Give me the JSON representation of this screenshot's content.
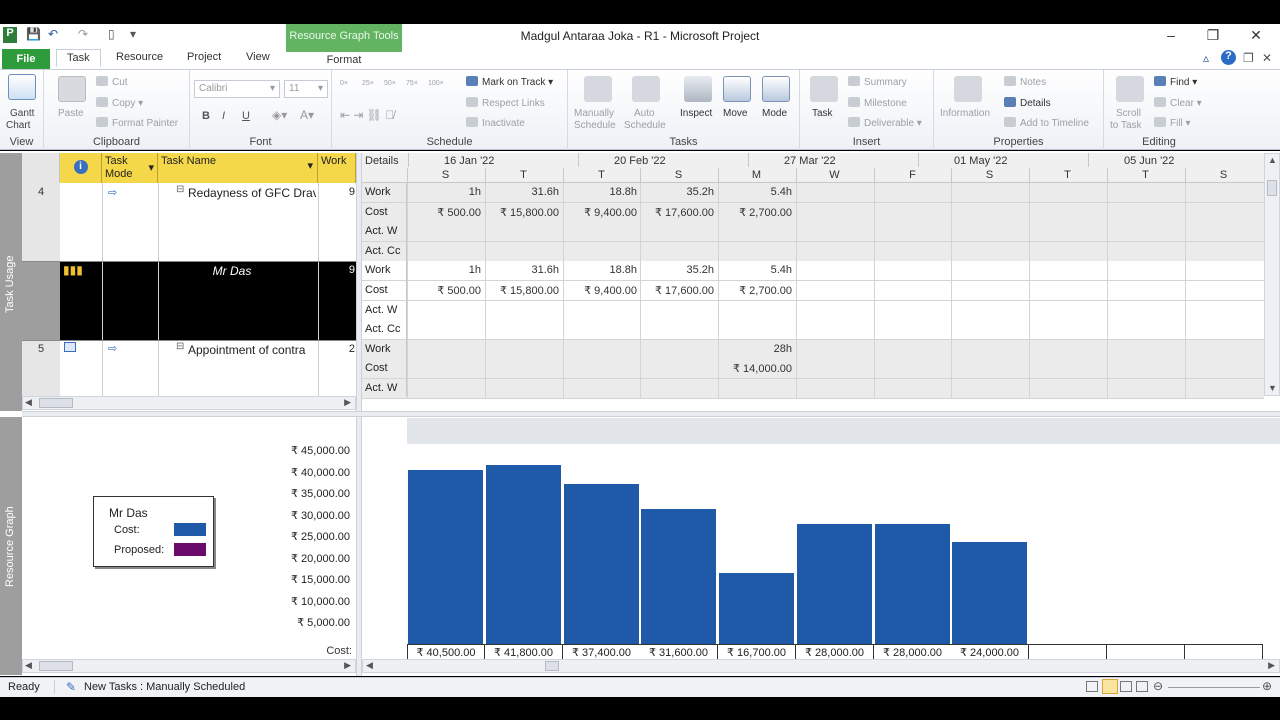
{
  "window": {
    "title": "Madgul Antaraa Joka - R1  -  Microsoft Project",
    "minimize": "–",
    "restore": "❐",
    "close": "✕"
  },
  "tabs": {
    "file": "File",
    "items": [
      "Task",
      "Resource",
      "Project",
      "View"
    ],
    "context_group": "Resource Graph Tools",
    "context_tab": "Format"
  },
  "ribbon": {
    "view": {
      "gantt": "Gantt",
      "chart": "Chart",
      "label": "View"
    },
    "clipboard": {
      "paste": "Paste",
      "cut": "Cut",
      "copy": "Copy",
      "format_painter": "Format Painter",
      "label": "Clipboard"
    },
    "font": {
      "family": "Calibri",
      "size": "11",
      "bold": "B",
      "italic": "I",
      "underline": "U",
      "label": "Font"
    },
    "schedule": {
      "percent": [
        "0×",
        "25×",
        "50×",
        "75×",
        "100×"
      ],
      "mark_on_track": "Mark on Track",
      "respect_links": "Respect Links",
      "inactivate": "Inactivate",
      "label": "Schedule"
    },
    "tasks": {
      "manually": "Manually",
      "manually2": "Schedule",
      "auto": "Auto",
      "auto2": "Schedule",
      "inspect": "Inspect",
      "move": "Move",
      "mode": "Mode",
      "label": "Tasks"
    },
    "insert": {
      "task": "Task",
      "summary": "Summary",
      "milestone": "Milestone",
      "deliverable": "Deliverable",
      "label": "Insert"
    },
    "properties": {
      "information": "Information",
      "notes": "Notes",
      "details": "Details",
      "add_to_timeline": "Add to Timeline",
      "label": "Properties"
    },
    "editing": {
      "scroll": "Scroll",
      "to_task": "to Task",
      "find": "Find",
      "clear": "Clear",
      "fill": "Fill",
      "label": "Editing"
    }
  },
  "side_tabs": {
    "top": "Task Usage",
    "bottom": "Resource Graph"
  },
  "task_table": {
    "headers": {
      "info": "i",
      "mode": "Task Mode",
      "name": "Task Name",
      "work": "Work"
    },
    "rows": [
      {
        "num": "4",
        "name": "Redayness of GFC Drav",
        "work": "9"
      },
      {
        "num": "",
        "name": "Mr Das",
        "work": "9"
      },
      {
        "num": "5",
        "name": "Appointment of contra",
        "work": "2"
      }
    ]
  },
  "timephased": {
    "details_header": "Details",
    "date_headers": [
      "16 Jan '22",
      "20 Feb '22",
      "27 Mar '22",
      "01 May '22",
      "05 Jun '22"
    ],
    "day_headers": [
      "S",
      "T",
      "T",
      "S",
      "M",
      "W",
      "F",
      "S",
      "T",
      "T",
      "S"
    ],
    "rows": [
      {
        "label": "Work",
        "values": [
          "1h",
          "31.6h",
          "18.8h",
          "35.2h",
          "5.4h",
          "",
          "",
          "",
          "",
          "",
          ""
        ],
        "shade": true
      },
      {
        "label": "Cost",
        "values": [
          "₹ 500.00",
          "₹ 15,800.00",
          "₹ 9,400.00",
          "₹ 17,600.00",
          "₹ 2,700.00",
          "",
          "",
          "",
          "",
          "",
          ""
        ],
        "shade": true
      },
      {
        "label": "Act. W",
        "values": [
          "",
          "",
          "",
          "",
          "",
          "",
          "",
          "",
          "",
          "",
          ""
        ],
        "shade": true
      },
      {
        "label": "Act. Cc",
        "values": [
          "",
          "",
          "",
          "",
          "",
          "",
          "",
          "",
          "",
          "",
          ""
        ],
        "shade": true
      },
      {
        "label": "Work",
        "values": [
          "1h",
          "31.6h",
          "18.8h",
          "35.2h",
          "5.4h",
          "",
          "",
          "",
          "",
          "",
          ""
        ],
        "shade": false
      },
      {
        "label": "Cost",
        "values": [
          "₹ 500.00",
          "₹ 15,800.00",
          "₹ 9,400.00",
          "₹ 17,600.00",
          "₹ 2,700.00",
          "",
          "",
          "",
          "",
          "",
          ""
        ],
        "shade": false
      },
      {
        "label": "Act. W",
        "values": [
          "",
          "",
          "",
          "",
          "",
          "",
          "",
          "",
          "",
          "",
          ""
        ],
        "shade": false
      },
      {
        "label": "Act. Cc",
        "values": [
          "",
          "",
          "",
          "",
          "",
          "",
          "",
          "",
          "",
          "",
          ""
        ],
        "shade": false
      },
      {
        "label": "Work",
        "values": [
          "",
          "",
          "",
          "",
          "28h",
          "",
          "",
          "",
          "",
          "",
          ""
        ],
        "shade": true
      },
      {
        "label": "Cost",
        "values": [
          "",
          "",
          "",
          "",
          "₹ 14,000.00",
          "",
          "",
          "",
          "",
          "",
          ""
        ],
        "shade": true
      },
      {
        "label": "Act. W",
        "values": [
          "",
          "",
          "",
          "",
          "",
          "",
          "",
          "",
          "",
          "",
          ""
        ],
        "shade": true
      }
    ]
  },
  "legend": {
    "resource": "Mr Das",
    "cost_label": "Cost:",
    "proposed_label": "Proposed:",
    "cost_color": "#1e5aa8",
    "proposed_color": "#6a0a6a"
  },
  "chart_data": {
    "type": "bar",
    "series": [
      {
        "name": "Cost",
        "values": [
          40500,
          41800,
          37400,
          31600,
          16700,
          28000,
          28000,
          24000
        ]
      }
    ],
    "categories": [
      "S",
      "T",
      "T",
      "S",
      "M",
      "W",
      "F",
      "S"
    ],
    "ylim": [
      0,
      45000
    ],
    "yticks": [
      "₹ 45,000.00",
      "₹ 40,000.00",
      "₹ 35,000.00",
      "₹ 30,000.00",
      "₹ 25,000.00",
      "₹ 20,000.00",
      "₹ 15,000.00",
      "₹ 10,000.00",
      "₹ 5,000.00"
    ],
    "ytick_values": [
      45000,
      40000,
      35000,
      30000,
      25000,
      20000,
      15000,
      10000,
      5000
    ],
    "cost_row_label": "Cost:",
    "cost_labels": [
      "₹ 40,500.00",
      "₹ 41,800.00",
      "₹ 37,400.00",
      "₹ 31,600.00",
      "₹ 16,700.00",
      "₹ 28,000.00",
      "₹ 28,000.00",
      "₹ 24,000.00",
      "",
      "",
      ""
    ],
    "bar_color": "#1e5aa8"
  },
  "status": {
    "ready": "Ready",
    "new_tasks": "New Tasks : Manually Scheduled"
  }
}
